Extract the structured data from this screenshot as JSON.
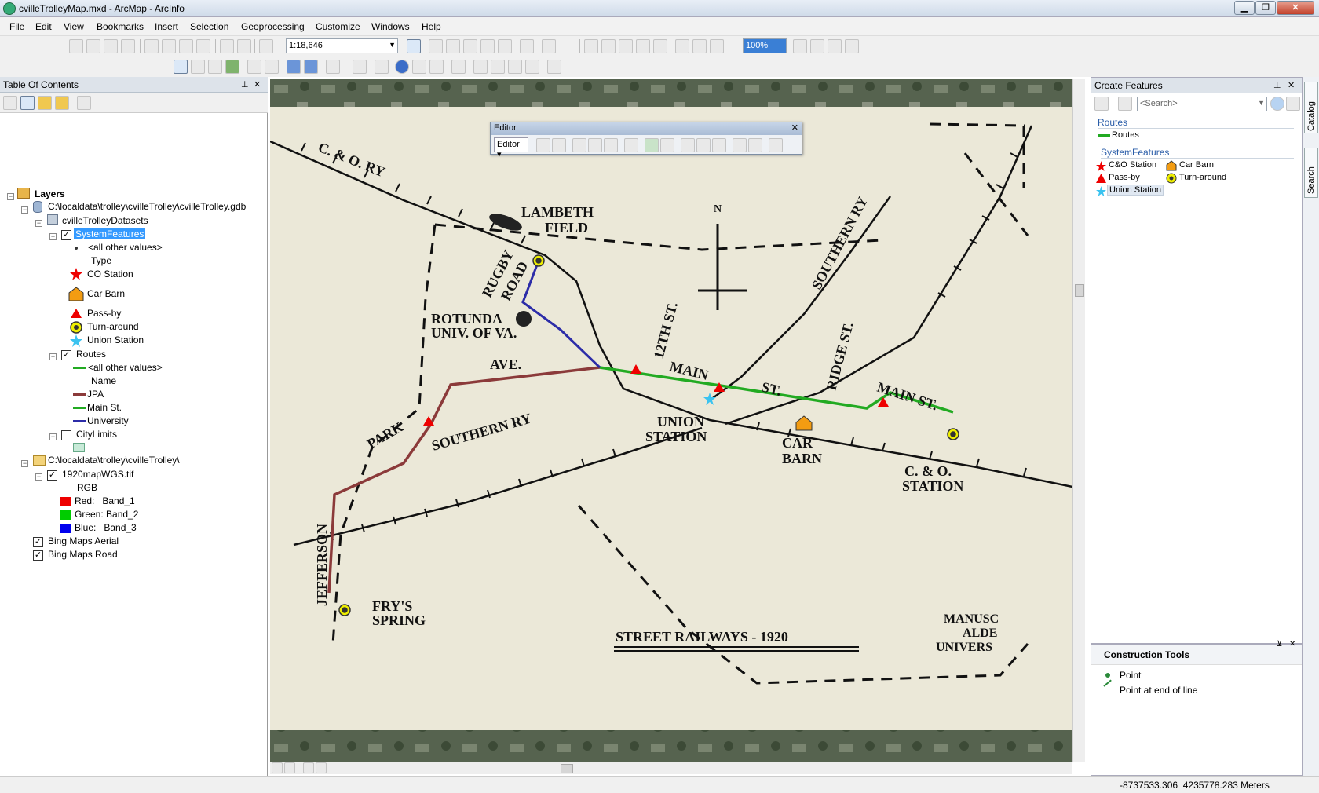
{
  "window": {
    "title": "cvilleTrolleyMap.mxd - ArcMap - ArcInfo"
  },
  "menu": [
    "File",
    "Edit",
    "View",
    "Bookmarks",
    "Insert",
    "Selection",
    "Geoprocessing",
    "Customize",
    "Windows",
    "Help"
  ],
  "toolbar": {
    "scale": "1:18,646",
    "zoom_pct": "100%"
  },
  "toc": {
    "title": "Table Of Contents",
    "layers_label": "Layers",
    "gdb_path": "C:\\localdata\\trolley\\cvilleTrolley\\cvilleTrolley.gdb",
    "dataset": "cvilleTrolleyDatasets",
    "system_features": "SystemFeatures",
    "sf_other": "<all other values>",
    "sf_field": "Type",
    "sf_items": [
      "CO Station",
      "Car Barn",
      "Pass-by",
      "Turn-around",
      "Union Station"
    ],
    "routes": "Routes",
    "rt_other": "<all other values>",
    "rt_field": "Name",
    "rt_items": [
      "JPA",
      "Main St.",
      "University"
    ],
    "citylimits": "CityLimits",
    "folder_path": "C:\\localdata\\trolley\\cvilleTrolley\\",
    "raster": "1920mapWGS.tif",
    "rgb": "RGB",
    "bands": [
      "Red:   Band_1",
      "Green: Band_2",
      "Blue:   Band_3"
    ],
    "bing_aerial": "Bing Maps Aerial",
    "bing_road": "Bing Maps Road"
  },
  "editor": {
    "title": "Editor",
    "menu": "Editor"
  },
  "create_features": {
    "title": "Create Features",
    "search_placeholder": "<Search>",
    "group_routes": "Routes",
    "routes_item": "Routes",
    "group_sf": "SystemFeatures",
    "items": [
      "C&O Station",
      "Car Barn",
      "Pass-by",
      "Turn-around",
      "Union Station"
    ]
  },
  "construction": {
    "title": "Construction Tools",
    "tools": [
      "Point",
      "Point at end of line"
    ]
  },
  "side_tabs": [
    "Catalog",
    "Search"
  ],
  "status": {
    "coords": "-8737533.306  4235778.283 Meters"
  },
  "map_labels": {
    "co_ry": "C. & O. RY",
    "lambeth1": "LAMBETH",
    "lambeth2": "FIELD",
    "rugby1": "RUGBY",
    "rugby2": "ROAD",
    "rotunda1": "ROTUNDA",
    "rotunda2": "UNIV. OF VA.",
    "north": "N",
    "southern_ry_ne": "SOUTHERN RY",
    "twelfth": "12TH ST.",
    "ridge": "RIDGE ST.",
    "main1": "MAIN",
    "st1": "ST.",
    "main2": "MAIN ST.",
    "ave": "AVE.",
    "park": "PARK",
    "southern_ry_sw": "SOUTHERN RY",
    "union1": "UNION",
    "union2": "STATION",
    "car1": "CAR",
    "car2": "BARN",
    "co1": "C. & O.",
    "co2": "STATION",
    "jefferson": "JEFFERSON",
    "frys1": "FRY'S",
    "frys2": "SPRING",
    "title": "STREET RAILWAYS - 1920",
    "manu1": "MANUSC",
    "manu2": "ALDE",
    "manu3": "UNIVERS"
  },
  "colors": {
    "jpa": "#8b3a3a",
    "main": "#22aa22",
    "university": "#2c2ca8",
    "paper": "#ebe8d8",
    "accent": "#3399ff"
  }
}
